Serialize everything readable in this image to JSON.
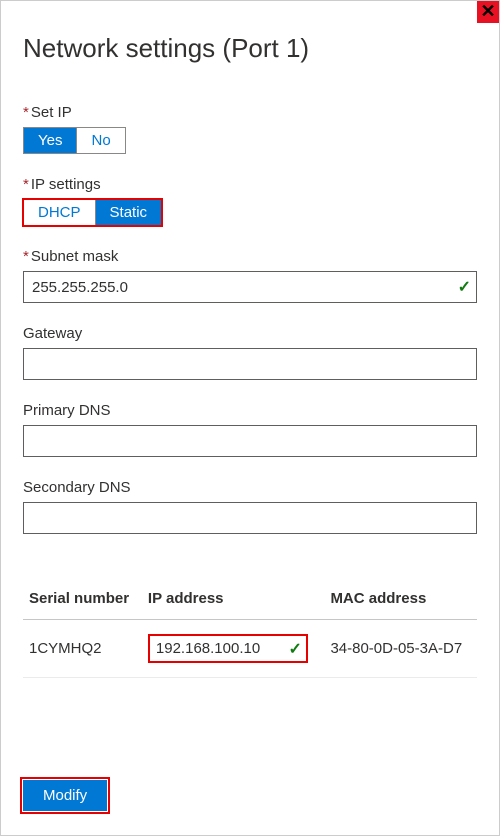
{
  "title": "Network settings (Port 1)",
  "close_label": "✕",
  "fields": {
    "set_ip": {
      "label": "Set IP",
      "required": true,
      "options": {
        "yes": "Yes",
        "no": "No"
      },
      "selected": "yes"
    },
    "ip_settings": {
      "label": "IP settings",
      "required": true,
      "options": {
        "dhcp": "DHCP",
        "static": "Static"
      },
      "selected": "static"
    },
    "subnet_mask": {
      "label": "Subnet mask",
      "required": true,
      "value": "255.255.255.0",
      "valid": true
    },
    "gateway": {
      "label": "Gateway",
      "value": ""
    },
    "primary_dns": {
      "label": "Primary DNS",
      "value": ""
    },
    "secondary_dns": {
      "label": "Secondary DNS",
      "value": ""
    }
  },
  "table": {
    "headers": {
      "serial": "Serial number",
      "ip": "IP address",
      "mac": "MAC address"
    },
    "row": {
      "serial": "1CYMHQ2",
      "ip": "192.168.100.10",
      "ip_valid": true,
      "mac": "34-80-0D-05-3A-D7"
    }
  },
  "buttons": {
    "modify": "Modify"
  },
  "required_marker": "*"
}
